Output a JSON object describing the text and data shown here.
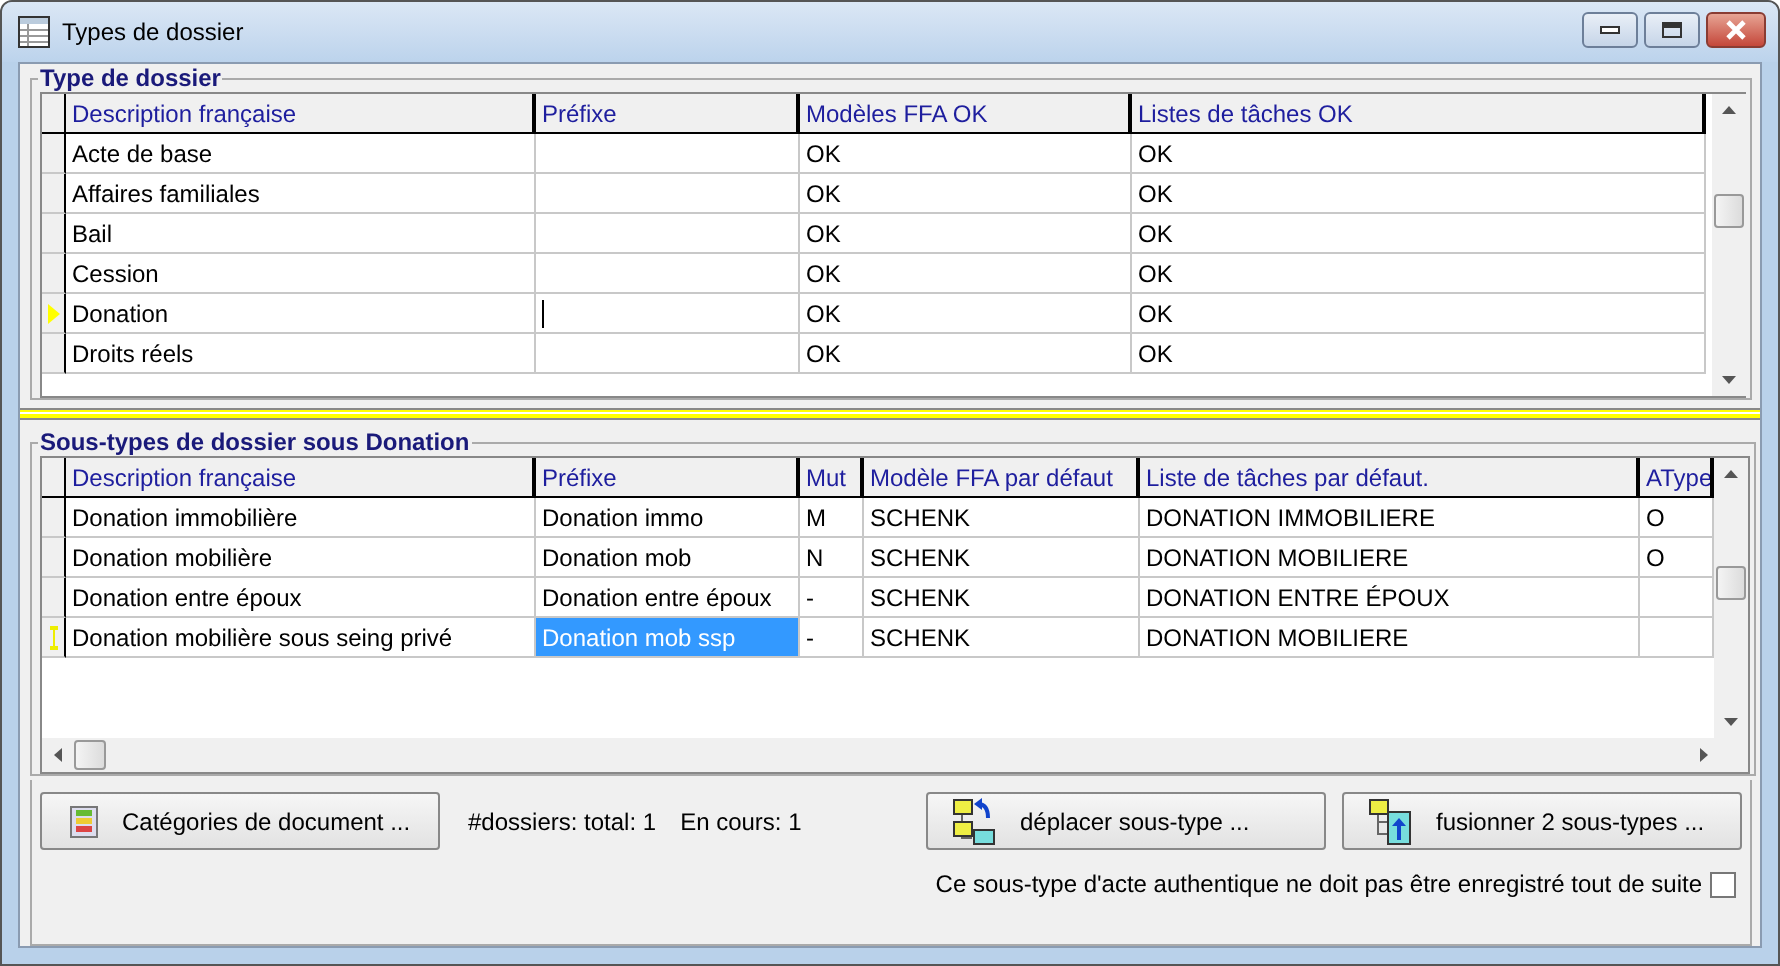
{
  "window": {
    "title": "Types de dossier"
  },
  "types_group": {
    "title": "Type de dossier",
    "columns": [
      "Description française",
      "Préfixe",
      "Modèles FFA OK",
      "Listes de tâches OK"
    ],
    "rows": [
      {
        "cells": [
          "Acte de base",
          "",
          "OK",
          "OK"
        ],
        "current": false
      },
      {
        "cells": [
          "Affaires familiales",
          "",
          "OK",
          "OK"
        ],
        "current": false
      },
      {
        "cells": [
          "Bail",
          "",
          "OK",
          "OK"
        ],
        "current": false
      },
      {
        "cells": [
          "Cession",
          "",
          "OK",
          "OK"
        ],
        "current": false
      },
      {
        "cells": [
          "Donation",
          "",
          "OK",
          "OK"
        ],
        "current": true
      },
      {
        "cells": [
          "Droits réels",
          "",
          "OK",
          "OK"
        ],
        "current": false
      }
    ]
  },
  "subtypes_group": {
    "title": "Sous-types de dossier sous Donation",
    "columns": [
      "Description française",
      "Préfixe",
      "Mut",
      "Modèle FFA par défaut",
      "Liste de tâches par défaut.",
      "AType"
    ],
    "rows": [
      {
        "cells": [
          "Donation immobilière",
          "Donation immo",
          "M",
          "SCHENK",
          "DONATION IMMOBILIERE",
          "O"
        ],
        "current": false
      },
      {
        "cells": [
          "Donation mobilière",
          "Donation mob",
          "N",
          "SCHENK",
          "DONATION MOBILIERE",
          "O"
        ],
        "current": false
      },
      {
        "cells": [
          "Donation entre époux",
          "Donation entre époux",
          "-",
          "SCHENK",
          "DONATION ENTRE ÉPOUX",
          ""
        ],
        "current": false
      },
      {
        "cells": [
          "Donation mobilière sous seing privé",
          "Donation mob ssp",
          "-",
          "SCHENK",
          "DONATION MOBILIERE",
          ""
        ],
        "current": true
      }
    ]
  },
  "buttons": [
    {
      "label": "Catégories de document ...",
      "kind": "categories"
    },
    {
      "label": "déplacer sous-type ...",
      "kind": "move"
    },
    {
      "label": "fusionner 2 sous-types ...",
      "kind": "merge"
    }
  ],
  "stats": {
    "total": "#dossiers:  total: 1",
    "in_progress": "En cours: 1"
  },
  "option": {
    "label": "Ce sous-type d'acte authentique ne doit pas être enregistré tout de suite",
    "checked": false
  }
}
